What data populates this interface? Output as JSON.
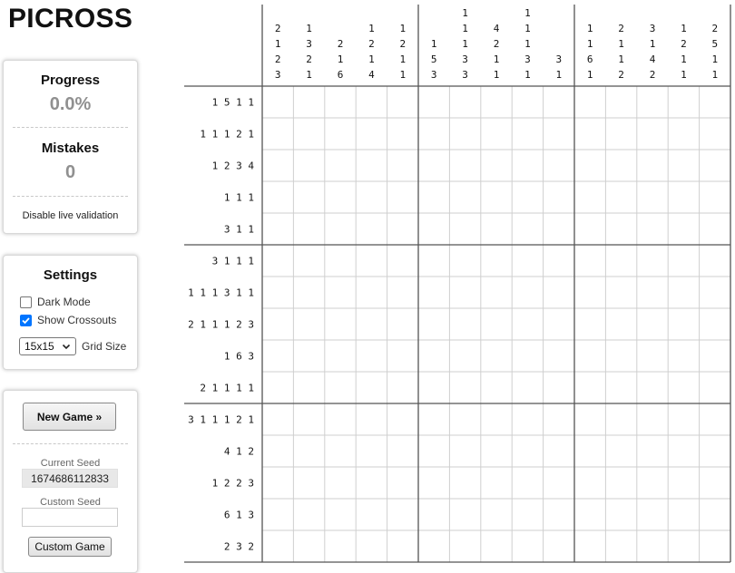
{
  "app": {
    "title": "PICROSS"
  },
  "stats": {
    "progress_label": "Progress",
    "progress_value": "0.0%",
    "mistakes_label": "Mistakes",
    "mistakes_value": "0",
    "validation_link": "Disable live validation"
  },
  "settings": {
    "title": "Settings",
    "dark_mode": {
      "label": "Dark Mode",
      "checked": false
    },
    "show_crossouts": {
      "label": "Show Crossouts",
      "checked": true
    },
    "grid_size": {
      "selected": "15x15",
      "label": "Grid Size"
    }
  },
  "game": {
    "new_game_label": "New Game »",
    "current_seed_label": "Current Seed",
    "current_seed_value": "1674686112833",
    "custom_seed_label": "Custom Seed",
    "custom_seed_value": "",
    "custom_game_label": "Custom Game"
  },
  "puzzle": {
    "size": 15,
    "column_clues": [
      [
        "2",
        "1",
        "2",
        "3"
      ],
      [
        "1",
        "3",
        "2",
        "1"
      ],
      [
        "2",
        "1",
        "6"
      ],
      [
        "1",
        "2",
        "1",
        "4"
      ],
      [
        "1",
        "2",
        "1",
        "1"
      ],
      [
        "1",
        "5",
        "3"
      ],
      [
        "1",
        "1",
        "1",
        "3",
        "3"
      ],
      [
        "4",
        "2",
        "1",
        "1"
      ],
      [
        "1",
        "1",
        "1",
        "3",
        "1"
      ],
      [
        "3",
        "1"
      ],
      [
        "1",
        "1",
        "6",
        "1"
      ],
      [
        "2",
        "1",
        "1",
        "2"
      ],
      [
        "3",
        "1",
        "4",
        "2"
      ],
      [
        "1",
        "2",
        "1",
        "1"
      ],
      [
        "2",
        "5",
        "1",
        "1"
      ]
    ],
    "row_clues": [
      "1 5 1 1",
      "1 1 1 2 1",
      "1 2 3 4",
      "1 1 1",
      "3 1 1",
      "3 1 1 1",
      "1 1 1 3 1 1",
      "2 1 1 1 2 3",
      "1 6 3",
      "2 1 1 1 1",
      "3 1 1 1 2 1",
      "4 1 2",
      "1 2 2 3",
      "6 1 3",
      "2 3 2"
    ]
  }
}
